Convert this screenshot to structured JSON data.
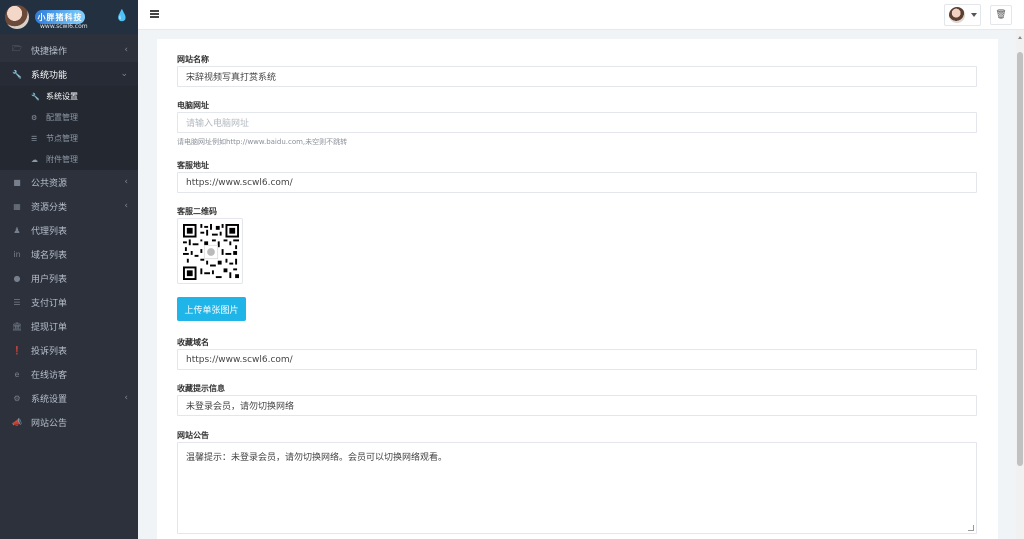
{
  "logo": {
    "brand": "小胖猪科技",
    "url": "www.scwl6.com"
  },
  "sidebar": {
    "items": [
      {
        "label": "快捷操作",
        "icon": "folder-icon",
        "arrow": "‹"
      },
      {
        "label": "系统功能",
        "icon": "wrench-icon",
        "arrow": "⌄"
      },
      {
        "label": "公共资源",
        "icon": "video-icon",
        "arrow": "‹"
      },
      {
        "label": "资源分类",
        "icon": "grid-icon",
        "arrow": "‹"
      },
      {
        "label": "代理列表",
        "icon": "users-icon",
        "arrow": ""
      },
      {
        "label": "域名列表",
        "icon": "linkedin-icon",
        "arrow": ""
      },
      {
        "label": "用户列表",
        "icon": "user-icon",
        "arrow": ""
      },
      {
        "label": "支付订单",
        "icon": "list-icon",
        "arrow": ""
      },
      {
        "label": "提现订单",
        "icon": "bank-icon",
        "arrow": ""
      },
      {
        "label": "投诉列表",
        "icon": "alert-icon",
        "arrow": ""
      },
      {
        "label": "在线访客",
        "icon": "ie-icon",
        "arrow": ""
      },
      {
        "label": "系统设置",
        "icon": "gear-icon",
        "arrow": "‹"
      },
      {
        "label": "网站公告",
        "icon": "bullhorn-icon",
        "arrow": ""
      }
    ],
    "subitems": [
      {
        "label": "系统设置",
        "icon": "wrench-icon"
      },
      {
        "label": "配置管理",
        "icon": "cogs-icon"
      },
      {
        "label": "节点管理",
        "icon": "list-icon"
      },
      {
        "label": "附件管理",
        "icon": "cloud-icon"
      }
    ]
  },
  "form": {
    "site_name_label": "网站名称",
    "site_name_value": "宋辞视频写真打赏系统",
    "pc_url_label": "电脑网址",
    "pc_url_placeholder": "请输入电脑网址",
    "pc_url_help": "请电脑网址例如http://www.baidu.com,未空则不跳转",
    "service_label": "客服地址",
    "service_value": "https://www.scwl6.com/",
    "qr_label": "客服二维码",
    "upload_label": "上传单张图片",
    "fav_domain_label": "收藏域名",
    "fav_domain_value": "https://www.scwl6.com/",
    "fav_tip_label": "收藏提示信息",
    "fav_tip_value": "未登录会员，请勿切换网络",
    "notice_label": "网站公告",
    "notice_value": "温馨提示：未登录会员，请勿切换网络。会员可以切换网络观看。"
  },
  "colors": {
    "sidebar_bg": "#2c313c",
    "accent": "#1fb5e8",
    "topbar_bg": "#ffffff"
  }
}
